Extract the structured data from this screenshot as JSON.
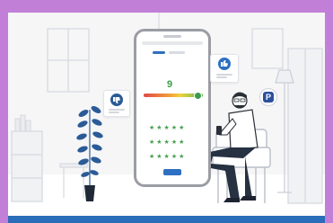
{
  "colors": {
    "frame": "#c27fd8",
    "scene_background": "#f6f6f7",
    "accent_blue": "#2d6fc0",
    "score_green": "#3c9b4a",
    "plant_blue": "#2b5b97"
  },
  "survey": {
    "question_nps": "",
    "score": "9",
    "score_fraction": 0.9,
    "question_rating": "",
    "star_rows": [
      "★★★★★",
      "★★★★★",
      "★★★★★"
    ],
    "submit_label": ""
  },
  "icons": {
    "thumbs_down": "thumbs-down-icon",
    "thumbs_up": "thumbs-up-icon",
    "parking_badge": "parking-icon"
  },
  "badge_letter": "P"
}
